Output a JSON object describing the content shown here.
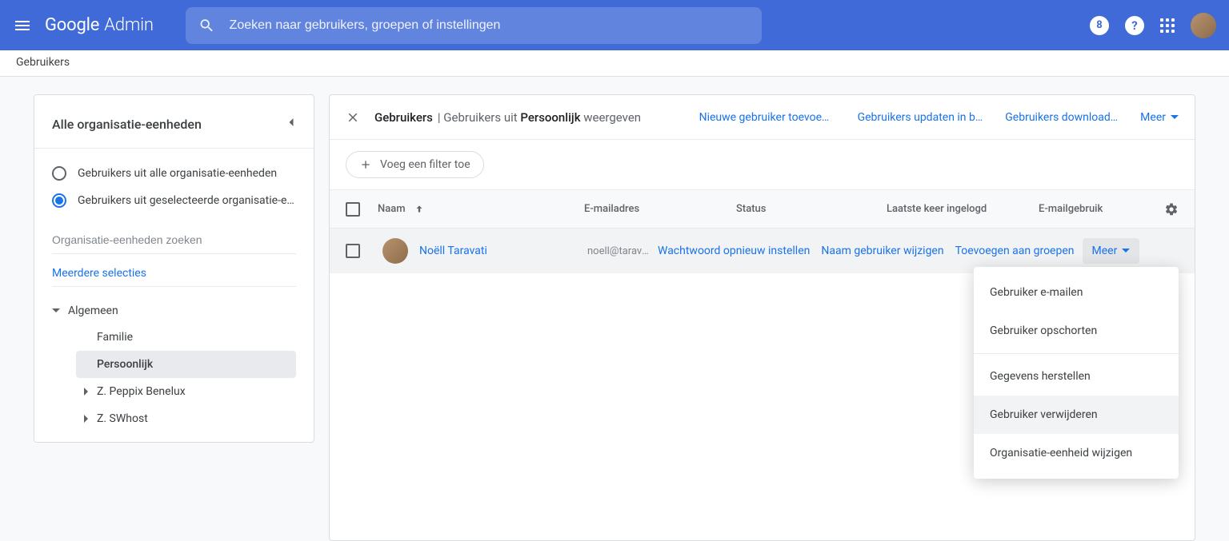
{
  "header": {
    "logo_google": "Google",
    "logo_admin": "Admin",
    "search_placeholder": "Zoeken naar gebruikers, groepen of instellingen",
    "badge_count": "8"
  },
  "breadcrumb": {
    "label": "Gebruikers"
  },
  "sidebar": {
    "title": "Alle organisatie-eenheden",
    "radio_all": "Gebruikers uit alle organisatie-eenheden",
    "radio_selected": "Gebruikers uit geselecteerde organisatie-eenh…",
    "search_placeholder": "Organisatie-eenheden zoeken",
    "multi_select": "Meerdere selecties",
    "tree_root": "Algemeen",
    "tree_children": {
      "familie": "Familie",
      "persoonlijk": "Persoonlijk",
      "peppix": "Z. Peppix Benelux",
      "swhost": "Z. SWhost"
    }
  },
  "content": {
    "header": {
      "title_bold1": "Gebruikers",
      "title_sep": " | ",
      "title_mid": "Gebruikers uit ",
      "title_bold2": "Persoonlijk",
      "title_end": " weergeven",
      "link_new": "Nieuwe gebruiker toevoeg…",
      "link_update": "Gebruikers updaten in b…",
      "link_download": "Gebruikers download…",
      "more": "Meer"
    },
    "filter": {
      "add": "Voeg een filter toe"
    },
    "columns": {
      "name": "Naam",
      "email": "E-mailadres",
      "status": "Status",
      "last_login": "Laatste keer ingelogd",
      "usage": "E-mailgebruik"
    },
    "row": {
      "name": "Noëll Taravati",
      "email": "noell@taravati",
      "action_reset": "Wachtwoord opnieuw instellen",
      "action_rename": "Naam gebruiker wijzigen",
      "action_groups": "Toevoegen aan groepen",
      "action_more": "Meer"
    },
    "dropdown": {
      "email_user": "Gebruiker e-mailen",
      "suspend": "Gebruiker opschorten",
      "restore": "Gegevens herstellen",
      "delete": "Gebruiker verwijderen",
      "change_ou": "Organisatie-eenheid wijzigen"
    }
  },
  "colors": {
    "primary": "#3f6ad8",
    "link": "#1a73e8"
  }
}
